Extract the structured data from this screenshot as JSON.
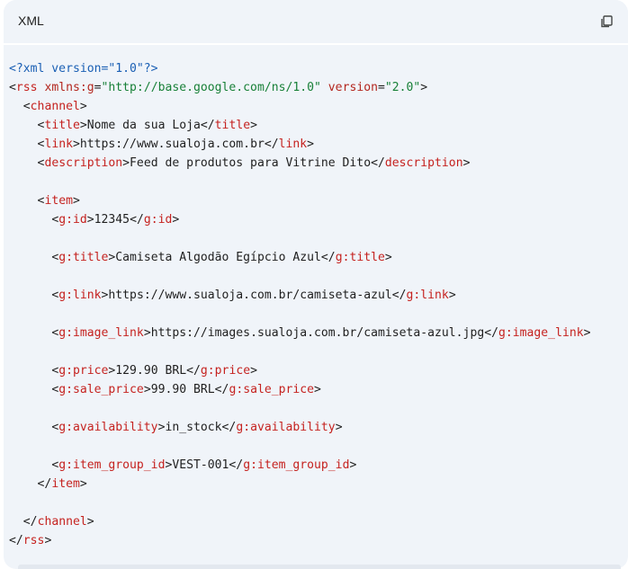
{
  "header": {
    "language_label": "XML",
    "copy_icon": "copy-icon"
  },
  "colors": {
    "background": "#f0f4f9",
    "tag": "#c5221f",
    "string": "#188038",
    "declaration": "#1a5fb4"
  },
  "code": {
    "lines": [
      "<?xml version=\"1.0\"?>",
      "<rss xmlns:g=\"http://base.google.com/ns/1.0\" version=\"2.0\">",
      "  <channel>",
      "    <title>Nome da sua Loja</title>",
      "    <link>https://www.sualoja.com.br</link>",
      "    <description>Feed de produtos para Vitrine Dito</description>",
      "",
      "    <item>",
      "      <g:id>12345</g:id>",
      "",
      "      <g:title>Camiseta Algodão Egípcio Azul</g:title>",
      "",
      "      <g:link>https://www.sualoja.com.br/camiseta-azul</g:link>",
      "",
      "      <g:image_link>https://images.sualoja.com.br/camiseta-azul.jpg</g:image_link>",
      "",
      "      <g:price>129.90 BRL</g:price>",
      "      <g:sale_price>99.90 BRL</g:sale_price>",
      "",
      "      <g:availability>in_stock</g:availability>",
      "",
      "      <g:item_group_id>VEST-001</g:item_group_id>",
      "    </item>",
      "",
      "  </channel>",
      "</rss>"
    ]
  }
}
